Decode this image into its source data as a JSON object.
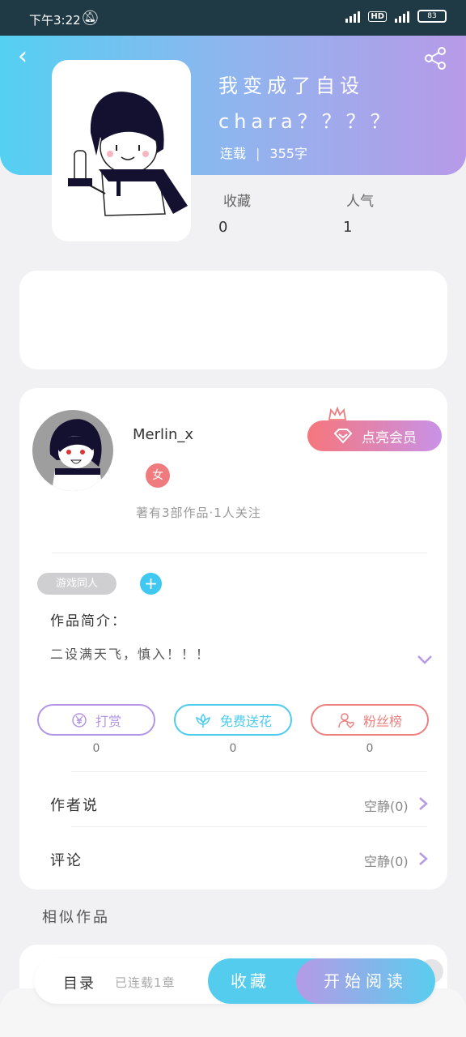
{
  "status_bar": {
    "time": "下午3:22",
    "network_left": "4G",
    "network_right": "4G",
    "hd_label": "HD",
    "battery": "83"
  },
  "book": {
    "title": "我变成了自设chara？？？？",
    "status": "连载",
    "word_count": "355字",
    "favorites_label": "收藏",
    "favorites_value": "0",
    "popularity_label": "人气",
    "popularity_value": "1"
  },
  "author": {
    "name": "Merlin_x",
    "gender_badge": "女",
    "meta": "著有3部作品·1人关注",
    "vip_button": "点亮会员"
  },
  "tags": {
    "tag1": "游戏同人",
    "add": "+"
  },
  "intro": {
    "label": "作品简介：",
    "text": "二设满天飞，慎入！！！"
  },
  "actions": {
    "tip_label": "打赏",
    "tip_count": "0",
    "tip_color": "#b295e6",
    "flower_label": "免费送花",
    "flower_count": "0",
    "flower_color": "#4ccbee",
    "fans_label": "粉丝榜",
    "fans_count": "0",
    "fans_color": "#ee7f7f"
  },
  "rows": {
    "author_says_label": "作者说",
    "author_says_value": "空静(0)",
    "comments_label": "评论",
    "comments_value": "空静(0)"
  },
  "similar": {
    "label": "相似作品"
  },
  "bottom": {
    "catalog_label": "目录",
    "catalog_status": "已连载1章",
    "favorite_button": "收藏",
    "read_button": "开始阅读"
  }
}
